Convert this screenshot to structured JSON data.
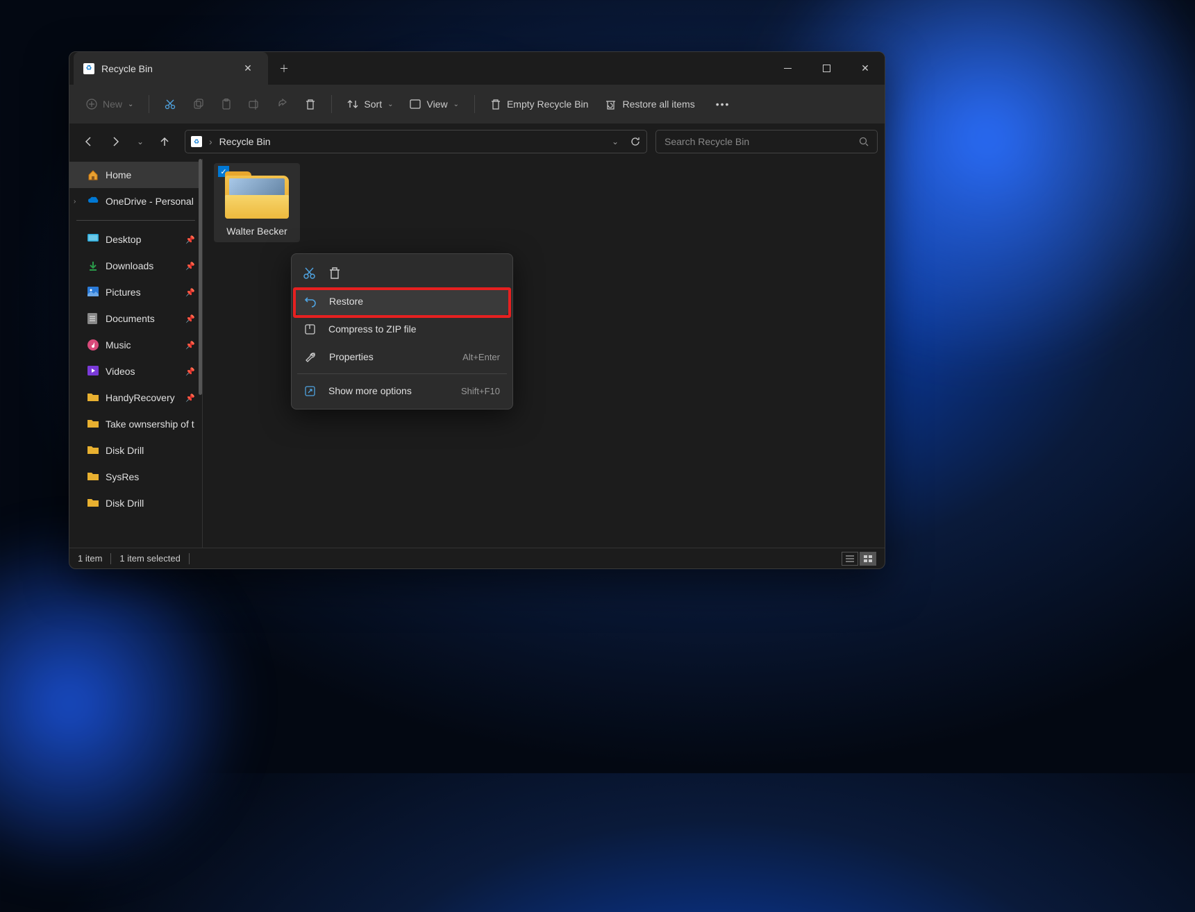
{
  "window": {
    "tab_title": "Recycle Bin"
  },
  "toolbar": {
    "new": "New",
    "sort": "Sort",
    "view": "View",
    "empty": "Empty Recycle Bin",
    "restore_all": "Restore all items"
  },
  "address": {
    "path": "Recycle Bin"
  },
  "search": {
    "placeholder": "Search Recycle Bin"
  },
  "sidebar": {
    "home": "Home",
    "onedrive": "OneDrive - Personal",
    "items": [
      "Desktop",
      "Downloads",
      "Pictures",
      "Documents",
      "Music",
      "Videos",
      "HandyRecovery",
      "Take ownsership of t",
      "Disk Drill",
      "SysRes",
      "Disk Drill"
    ]
  },
  "file": {
    "name": "Walter Becker"
  },
  "context_menu": {
    "restore": "Restore",
    "compress": "Compress to ZIP file",
    "properties": "Properties",
    "properties_shortcut": "Alt+Enter",
    "show_more": "Show more options",
    "show_more_shortcut": "Shift+F10"
  },
  "status": {
    "count": "1 item",
    "selected": "1 item selected"
  }
}
